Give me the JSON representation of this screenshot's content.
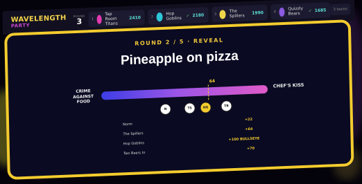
{
  "header": {
    "logo_line1": "WAVELENGTH",
    "logo_line2": "PARTY",
    "round_label": "ROUND",
    "round_value": "3",
    "timer": "3 teams"
  },
  "teams": [
    {
      "rank": "1",
      "name": "Tap Room Titans",
      "score": "2410",
      "color": "#e23ab0",
      "check": ""
    },
    {
      "rank": "2",
      "name": "Hop Goblins",
      "score": "2180",
      "color": "#2ec6d6",
      "check": "✓"
    },
    {
      "rank": "3",
      "name": "The Spillers",
      "score": "1990",
      "color": "#f0d54a",
      "check": ""
    },
    {
      "rank": "4",
      "name": "Quizzly Bears",
      "score": "1685",
      "color": "#8a5ae0",
      "check": "✓"
    }
  ],
  "main": {
    "round_title": "ROUND 2 / 5 · REVEAL",
    "prompt": "Pineapple on pizza",
    "left_label": "CRIME AGAINST FOOD",
    "right_label": "CHEF'S KISS",
    "target_value": "64",
    "target_fraction": 0.64
  },
  "guesses": [
    {
      "abbr": "N",
      "highlight": false
    },
    {
      "abbr": "TS",
      "highlight": false
    },
    {
      "abbr": "HG",
      "highlight": true
    },
    {
      "abbr": "TB",
      "highlight": false
    }
  ],
  "results": [
    {
      "team": "Norm",
      "points": "+22"
    },
    {
      "team": "The Spillers",
      "points": "+64"
    },
    {
      "team": "Hop Goblins",
      "points": "+100 BULLSEYE"
    },
    {
      "team": "Two Beers In",
      "points": "+70"
    }
  ]
}
